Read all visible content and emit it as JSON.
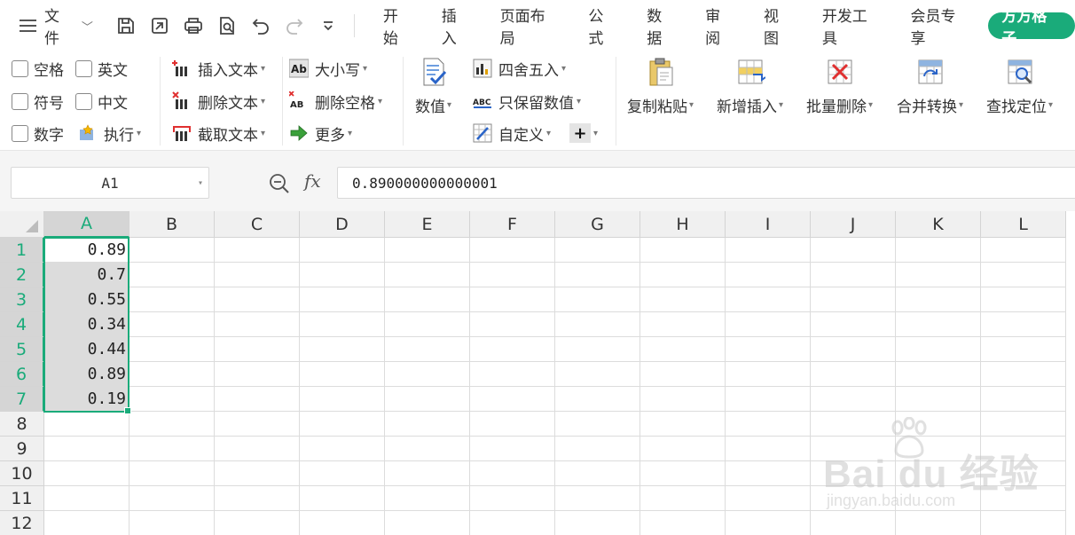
{
  "menubar": {
    "file_label": "文件",
    "tabs": [
      "开始",
      "插入",
      "页面布局",
      "公式",
      "数据",
      "审阅",
      "视图",
      "开发工具",
      "会员专享"
    ],
    "special_tab": "方方格子",
    "accent_color": "#1aab7a"
  },
  "quick_access": [
    "save-icon",
    "export-icon",
    "print-icon",
    "print-preview-icon",
    "undo-icon",
    "redo-icon",
    "more-icon"
  ],
  "ribbon": {
    "checkboxes": [
      "空格",
      "英文",
      "符号",
      "中文",
      "数字"
    ],
    "exec": "执行",
    "text_ops": [
      "插入文本",
      "删除文本",
      "截取文本"
    ],
    "case_ops": [
      "大小写",
      "删除空格",
      "更多"
    ],
    "value": "数值",
    "round_ops": [
      "四舍五入",
      "只保留数值",
      "自定义"
    ],
    "big_buttons": [
      "复制粘贴",
      "新增插入",
      "批量删除",
      "合并转换",
      "查找定位"
    ]
  },
  "formula_bar": {
    "name_box": "A1",
    "fx": "fx",
    "value": "0.890000000000001"
  },
  "grid": {
    "columns": [
      "A",
      "B",
      "C",
      "D",
      "E",
      "F",
      "G",
      "H",
      "I",
      "J",
      "K",
      "L"
    ],
    "rows": [
      "1",
      "2",
      "3",
      "4",
      "5",
      "6",
      "7",
      "8",
      "9",
      "10",
      "11",
      "12"
    ],
    "col_a_values": [
      "0.89",
      "0.7",
      "0.55",
      "0.34",
      "0.44",
      "0.89",
      "0.19"
    ],
    "selected_column": "A",
    "selected_rows": [
      "1",
      "2",
      "3",
      "4",
      "5",
      "6",
      "7"
    ]
  },
  "watermark": {
    "brand": "Bai du 经验",
    "url": "jingyan.baidu.com"
  }
}
